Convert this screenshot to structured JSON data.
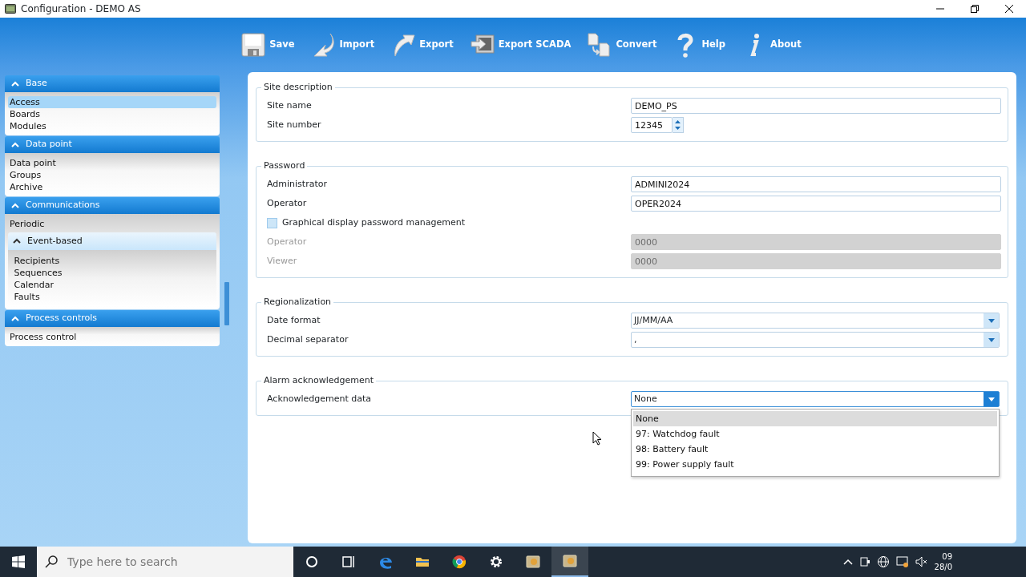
{
  "window": {
    "title": "Configuration - DEMO AS"
  },
  "toolbar": [
    {
      "kind": "save",
      "label": "Save"
    },
    {
      "kind": "import",
      "label": "Import"
    },
    {
      "kind": "export",
      "label": "Export"
    },
    {
      "kind": "scada",
      "label": "Export SCADA"
    },
    {
      "kind": "convert",
      "label": "Convert"
    },
    {
      "kind": "help",
      "label": "Help"
    },
    {
      "kind": "about",
      "label": "About"
    }
  ],
  "sidebar": [
    {
      "title": "Base",
      "expanded": true,
      "items": [
        {
          "kind": "item",
          "label": "Access",
          "selected": true
        },
        {
          "kind": "item",
          "label": "Boards",
          "selected": false
        },
        {
          "kind": "item",
          "label": "Modules",
          "selected": false
        }
      ]
    },
    {
      "title": "Data point",
      "expanded": true,
      "items": [
        {
          "kind": "item",
          "label": "Data point",
          "selected": false
        },
        {
          "kind": "item",
          "label": "Groups",
          "selected": false
        },
        {
          "kind": "item",
          "label": "Archive",
          "selected": false
        }
      ]
    },
    {
      "title": "Communications",
      "expanded": true,
      "items": [
        {
          "kind": "item",
          "label": "Periodic",
          "selected": false
        },
        {
          "kind": "group",
          "label": "Event-based",
          "expanded": true,
          "children": [
            {
              "kind": "item",
              "label": "Recipients",
              "selected": false
            },
            {
              "kind": "item",
              "label": "Sequences",
              "selected": false
            },
            {
              "kind": "item",
              "label": "Calendar",
              "selected": false
            },
            {
              "kind": "item",
              "label": "Faults",
              "selected": false
            }
          ]
        }
      ]
    },
    {
      "title": "Process controls",
      "expanded": true,
      "items": [
        {
          "kind": "item",
          "label": "Process control",
          "selected": false
        }
      ]
    }
  ],
  "sections": [
    {
      "title": "Site description",
      "rows": [
        {
          "kind": "text",
          "label": "Site name",
          "value": "DEMO_PS"
        },
        {
          "kind": "spin",
          "label": "Site number",
          "value": "12345"
        }
      ]
    },
    {
      "title": "Password",
      "rows": [
        {
          "kind": "text",
          "label": "Administrator",
          "value": "ADMINI2024"
        },
        {
          "kind": "text",
          "label": "Operator",
          "value": "OPER2024"
        },
        {
          "kind": "checkbox",
          "label": "Graphical display password management",
          "checked": false
        },
        {
          "kind": "text",
          "label": "Operator",
          "value": "0000",
          "disabled": true
        },
        {
          "kind": "text",
          "label": "Viewer",
          "value": "0000",
          "disabled": true
        }
      ]
    },
    {
      "title": "Regionalization",
      "rows": [
        {
          "kind": "combo",
          "label": "Date format",
          "value": "JJ/MM/AA",
          "open": false
        },
        {
          "kind": "combo",
          "label": "Decimal separator",
          "value": ",",
          "open": false
        }
      ]
    },
    {
      "title": "Alarm acknowledgement",
      "rows": [
        {
          "kind": "combo",
          "label": "Acknowledgement data",
          "value": "None",
          "open": true,
          "options": [
            {
              "label": "None",
              "selected": true
            },
            {
              "label": "97: Watchdog fault",
              "selected": false
            },
            {
              "label": "98: Battery fault",
              "selected": false
            },
            {
              "label": "99: Power supply fault",
              "selected": false
            }
          ]
        }
      ]
    }
  ],
  "taskbar": {
    "search": {
      "placeholder": "Type here to search"
    },
    "apps": [
      {
        "kind": "cortana",
        "active": false
      },
      {
        "kind": "taskview",
        "active": false
      },
      {
        "kind": "edge",
        "active": false
      },
      {
        "kind": "folder",
        "active": false
      },
      {
        "kind": "chrome",
        "active": false
      },
      {
        "kind": "gear",
        "active": false
      },
      {
        "kind": "app",
        "active": false
      },
      {
        "kind": "app",
        "active": true
      }
    ],
    "clock": {
      "time": "09",
      "date": "28/0"
    }
  }
}
